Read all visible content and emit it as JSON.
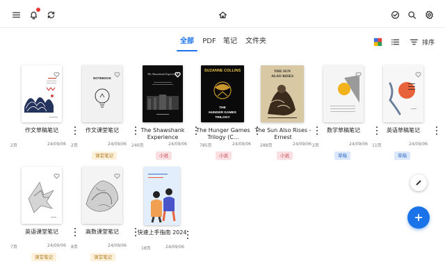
{
  "tabs": [
    {
      "label": "全部",
      "active": true
    },
    {
      "label": "PDF",
      "active": false
    },
    {
      "label": "笔记",
      "active": false
    },
    {
      "label": "文件夹",
      "active": false
    }
  ],
  "toolbar": {
    "sort_label": "排序"
  },
  "colors": {
    "accent": "#1a73e8",
    "notification_dot": "#e53935"
  },
  "books": [
    {
      "title": "作文草稿笔记",
      "pages": "2页",
      "date": "24/09/06",
      "tag": null,
      "cover_text": ""
    },
    {
      "title": "作文课堂笔记",
      "pages": "2页",
      "date": "24/09/06",
      "tag": {
        "label": "课堂笔记",
        "bg": "#fdf1dc",
        "color": "#b07a1f"
      },
      "cover_text": "NOTEBOOK"
    },
    {
      "title": "The Shawshank Experience",
      "pages": "240页",
      "date": "24/09/06",
      "tag": {
        "label": "小说",
        "bg": "#fbe0e3",
        "color": "#c24a58"
      },
      "cover_text": "The Shawshank Experience"
    },
    {
      "title": "The Hunger Games Trilogy (C...",
      "pages": "785页",
      "date": "24/09/06",
      "tag": {
        "label": "小说",
        "bg": "#fbe0e3",
        "color": "#c24a58"
      },
      "cover_text": "SUZANNE COLLINS"
    },
    {
      "title": "The Sun Also Rises - Ernest",
      "pages": "288页",
      "date": "24/09/06",
      "tag": {
        "label": "小说",
        "bg": "#fbe0e3",
        "color": "#c24a58"
      },
      "cover_text": "THE SUN ALSO RISES"
    },
    {
      "title": "数学草稿笔记",
      "pages": "2页",
      "date": "24/09/06",
      "tag": {
        "label": "草稿",
        "bg": "#dbe8fb",
        "color": "#3a6fc4"
      },
      "cover_text": ""
    },
    {
      "title": "英语草稿笔记",
      "pages": "11页",
      "date": "24/09/06",
      "tag": {
        "label": "草稿",
        "bg": "#dbe8fb",
        "color": "#3a6fc4"
      },
      "cover_text": ""
    },
    {
      "title": "英语课堂笔记",
      "pages": "7页",
      "date": "24/09/06",
      "tag": {
        "label": "课堂笔记",
        "bg": "#fdf1dc",
        "color": "#b07a1f"
      },
      "cover_text": ""
    },
    {
      "title": "高数课堂笔记",
      "pages": "8页",
      "date": "24/09/06",
      "tag": {
        "label": "课堂笔记",
        "bg": "#fdf1dc",
        "color": "#b07a1f"
      },
      "cover_text": ""
    },
    {
      "title": "快速上手指南 2024",
      "pages": "18页",
      "date": "24/09/06",
      "tag": null,
      "cover_text": ""
    }
  ]
}
